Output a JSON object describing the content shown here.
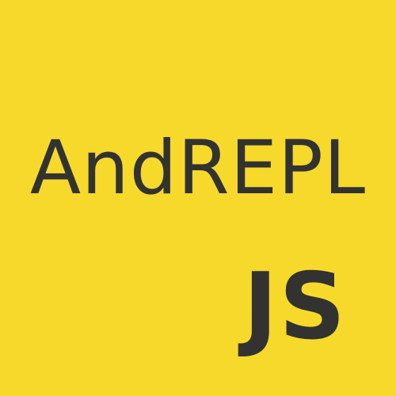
{
  "logo": {
    "title": "AndREPL",
    "tag": "JS",
    "colors": {
      "background": "#f7d92c",
      "text": "#323330"
    }
  }
}
